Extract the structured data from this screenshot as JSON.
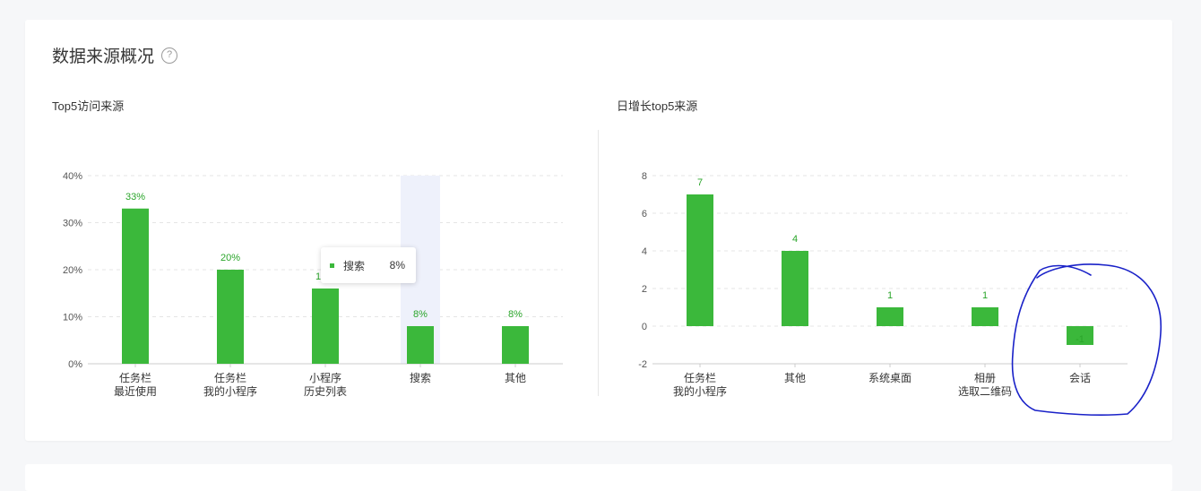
{
  "page": {
    "title": "数据来源概况",
    "help_icon": "?"
  },
  "colors": {
    "bar": "#3bb83b",
    "label": "#2aa52a",
    "grid": "#e5e5e5",
    "axis": "#cccccc",
    "tick": "#555555",
    "highlight": "#eef1fb",
    "annotation": "#1a22c8"
  },
  "chart_data": [
    {
      "type": "bar",
      "title": "Top5访问来源",
      "categories": [
        [
          "任务栏",
          "最近使用"
        ],
        [
          "任务栏",
          "我的小程序"
        ],
        [
          "小程序",
          "历史列表"
        ],
        [
          "搜索"
        ],
        [
          "其他"
        ]
      ],
      "values": [
        33,
        20,
        16,
        8,
        8
      ],
      "value_labels": [
        "33%",
        "20%",
        "16%",
        "8%",
        "8%"
      ],
      "y_ticks": [
        "0%",
        "10%",
        "20%",
        "30%",
        "40%"
      ],
      "ylim": [
        0,
        40
      ],
      "grid": true,
      "highlight_index": 3,
      "tooltip": {
        "name": "搜索",
        "value": "8%"
      }
    },
    {
      "type": "bar",
      "title": "日增长top5来源",
      "categories": [
        [
          "任务栏",
          "我的小程序"
        ],
        [
          "其他"
        ],
        [
          "系统桌面"
        ],
        [
          "相册",
          "选取二维码"
        ],
        [
          "会话"
        ]
      ],
      "values": [
        7,
        4,
        1,
        1,
        -1
      ],
      "value_labels": [
        "7",
        "4",
        "1",
        "1",
        "-1"
      ],
      "y_ticks": [
        "-2",
        "0",
        "2",
        "4",
        "6",
        "8"
      ],
      "ylim": [
        -2,
        8
      ],
      "grid": true
    }
  ]
}
